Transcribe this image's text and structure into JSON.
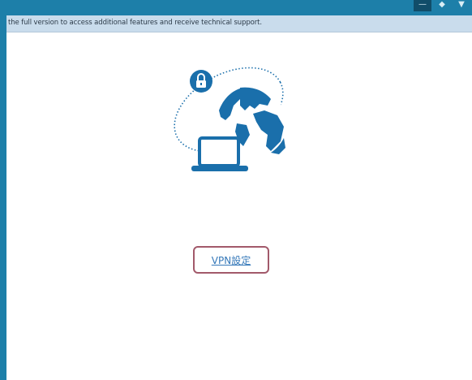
{
  "window": {
    "controls": {
      "minimize_glyph": "—",
      "maximize_glyph": "◆",
      "close_glyph": "▼"
    }
  },
  "trial_banner": {
    "text": "the full version to access additional features and receive technical support."
  },
  "hero": {
    "illustration_icons": [
      "globe-icon",
      "laptop-icon",
      "lock-icon"
    ],
    "colors": {
      "primary": "#1a6fab",
      "orbit": "#1a6fab"
    }
  },
  "main": {
    "vpn_settings_link": "VPN設定",
    "highlight_color": "#a2596a"
  }
}
